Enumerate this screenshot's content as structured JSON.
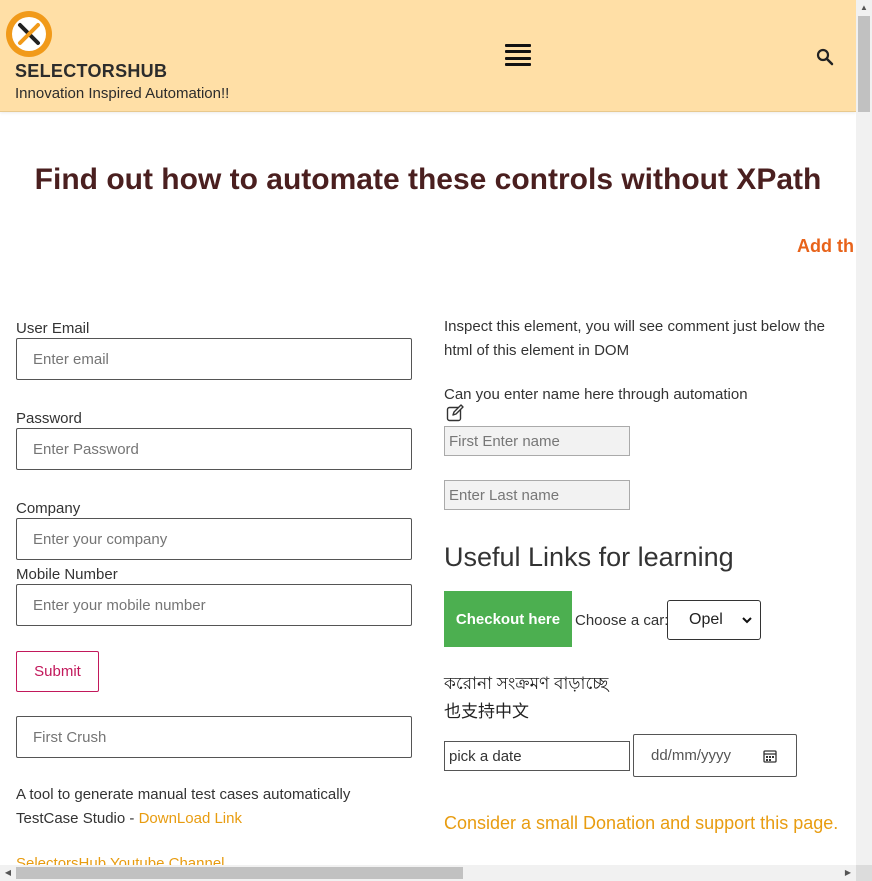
{
  "header": {
    "site_title": "SELECTORSHUB",
    "tagline": "Innovation Inspired Automation!!",
    "icons": {
      "logo": "selectorshub-logo",
      "menu": "hamburger-menu-icon",
      "search": "search-icon"
    }
  },
  "main": {
    "heading": "Find out how to automate these controls without XPath",
    "marquee_text": "Add th"
  },
  "form": {
    "email_label": "User Email",
    "email_placeholder": "Enter email",
    "password_label": "Password",
    "password_placeholder": "Enter Password",
    "company_label": "Company",
    "company_placeholder": "Enter your company",
    "mobile_label": "Mobile Number",
    "mobile_placeholder": "Enter your mobile number",
    "submit_label": "Submit",
    "first_crush_placeholder": "First Crush"
  },
  "left_bottom": {
    "tool_text": "A tool to generate manual test cases automatically",
    "testcase_prefix": "TestCase Studio - ",
    "download_link": "DownLoad Link",
    "youtube_link": "SelectorsHub Youtube Channel"
  },
  "right": {
    "inspect_text": "Inspect this element, you will see comment just below the html of this element in DOM",
    "enter_name_text": "Can you enter name here through automation",
    "first_name_placeholder": "First Enter name",
    "last_name_placeholder": "Enter Last name",
    "useful_links_heading": "Useful Links for learning",
    "checkout_label": "Checkout here",
    "car_label": "Choose a car:",
    "car_selected": "Opel",
    "bengali_text": "করোনা সংক্রমণ বাড়াচ্ছে",
    "chinese_text": "也支持中文",
    "pick_date_value": "pick a date",
    "date_placeholder": "dd/mm/yyyy",
    "donation_text": "Consider a small Donation and support this page."
  },
  "colors": {
    "header_bg": "#ffdfa6",
    "heading": "#4a1f1f",
    "accent_orange": "#e89c10",
    "marquee": "#e8631a",
    "submit_border": "#c2185b",
    "checkout_bg": "#4caf50"
  }
}
